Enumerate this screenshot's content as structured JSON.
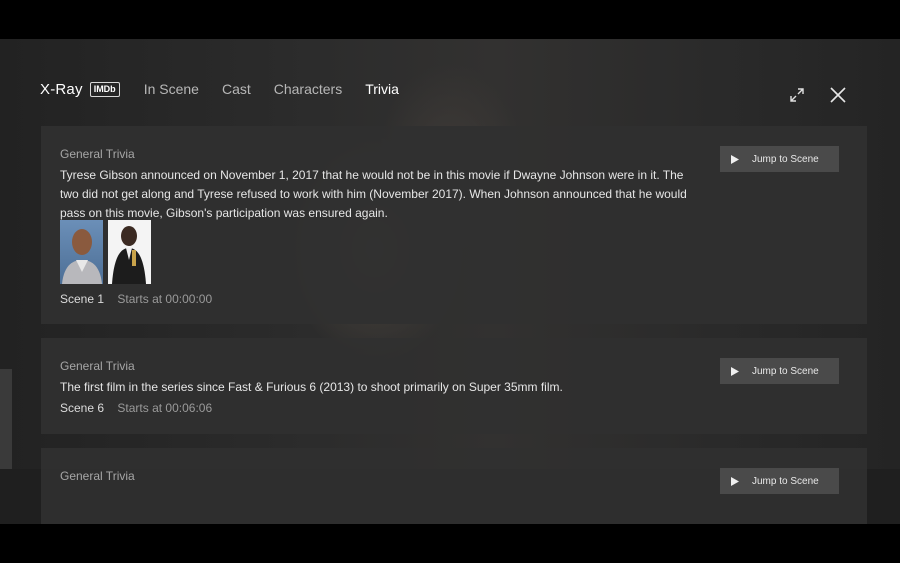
{
  "header": {
    "brand": "X-Ray",
    "badge": "IMDb",
    "tabs": [
      {
        "label": "In Scene",
        "active": false
      },
      {
        "label": "Cast",
        "active": false
      },
      {
        "label": "Characters",
        "active": false
      },
      {
        "label": "Trivia",
        "active": true
      }
    ],
    "icons": [
      "expand-icon",
      "close-icon"
    ]
  },
  "trivia": [
    {
      "category": "General Trivia",
      "text": "Tyrese Gibson announced on November 1, 2017 that he would not be in this movie if Dwayne Johnson were in it. The two did not get along and Tyrese refused to work with him (November 2017). When Johnson announced that he would pass on this movie, Gibson's participation was ensured again.",
      "scene": "Scene 1",
      "starts": "Starts at 00:00:00",
      "button": "Jump to Scene"
    },
    {
      "category": "General Trivia",
      "text": "The first film in the series since Fast & Furious 6 (2013) to shoot primarily on Super 35mm film.",
      "scene": "Scene 6",
      "starts": "Starts at 00:06:06",
      "button": "Jump to Scene"
    },
    {
      "category": "General Trivia",
      "button": "Jump to Scene"
    }
  ],
  "colors": {
    "background": "#000000",
    "card": "#303030",
    "button": "#4a4a4a",
    "active_tab": "#ffffff",
    "inactive_tab": "#b7b7b7"
  }
}
